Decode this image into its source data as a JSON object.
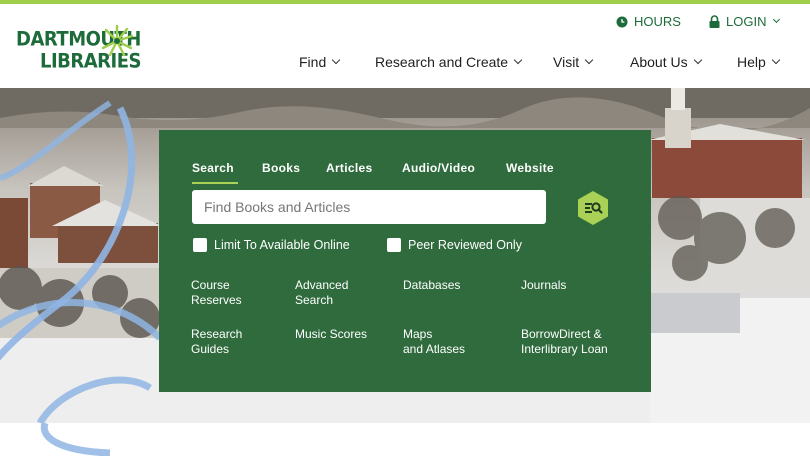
{
  "brand": {
    "line1": "DARTMOUTH",
    "line2": "LIBRARIES",
    "color": "#1d6b3a",
    "accent": "#9fce4a"
  },
  "utility": {
    "hours": "HOURS",
    "login": "LOGIN"
  },
  "nav": [
    {
      "label": "Find"
    },
    {
      "label": "Research and Create"
    },
    {
      "label": "Visit"
    },
    {
      "label": "About Us"
    },
    {
      "label": "Help"
    }
  ],
  "search": {
    "tabs": [
      "Search",
      "Books",
      "Articles",
      "Audio/Video",
      "Website"
    ],
    "active_tab": "Search",
    "placeholder": "Find Books and Articles",
    "value": "",
    "filters": [
      "Limit To Available Online",
      "Peer Reviewed Only"
    ],
    "panel_color": "#2f6b3c",
    "button_color": "#a8d155"
  },
  "quick_links": [
    {
      "label": "Course\nReserves"
    },
    {
      "label": "Advanced\nSearch"
    },
    {
      "label": "Databases"
    },
    {
      "label": "Journals"
    },
    {
      "label": "Research\nGuides"
    },
    {
      "label": "Music Scores"
    },
    {
      "label": "Maps\nand Atlases"
    },
    {
      "label": "BorrowDirect &\nInterlibrary Loan"
    }
  ]
}
